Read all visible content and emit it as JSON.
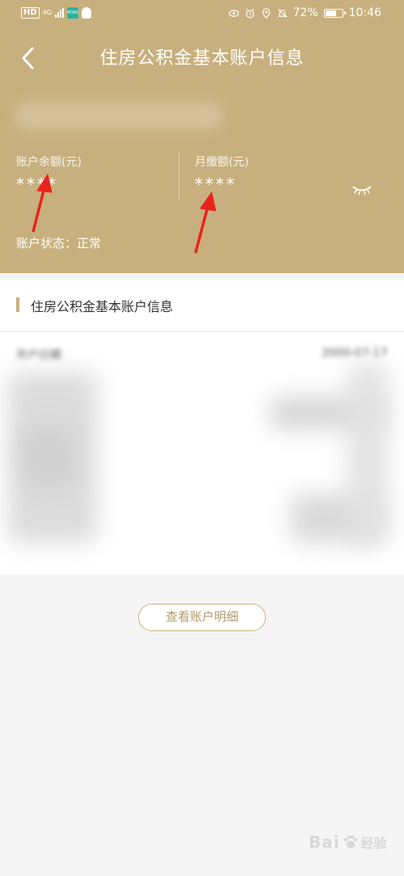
{
  "status_bar": {
    "left_badges": [
      "HD",
      "4G"
    ],
    "app_icon_label": "MTAS",
    "icons": [
      "eye-icon",
      "alarm-icon",
      "location-icon",
      "mute-icon"
    ],
    "battery_percent": "72%",
    "battery_level": 0.72,
    "time": "10:46"
  },
  "header": {
    "title": "住房公积金基本账户信息",
    "back_icon": "chevron-left-icon",
    "balance_label": "账户余额(元)",
    "balance_value": "****",
    "monthly_label": "月缴额(元)",
    "monthly_value": "****",
    "eye_icon": "eye-closed-icon",
    "status_text": "账户状态：正常",
    "background_color": "#c8b07e",
    "annotation_arrow_color": "#e8231b"
  },
  "section": {
    "title": "住房公积金基本账户信息",
    "first_row_label": "开户日期",
    "first_row_value": "2000-07-17"
  },
  "actions": {
    "view_detail_label": "查看账户明细"
  },
  "watermark": {
    "brand": "Bai",
    "brand_suffix": "经验"
  }
}
